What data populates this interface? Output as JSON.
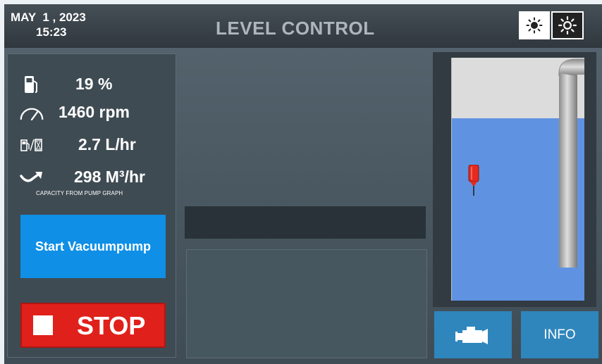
{
  "header": {
    "date": "MAY  1 , 2023",
    "time": "15:23",
    "title": "LEVEL CONTROL",
    "theme_light_icon": "sun-outline-icon",
    "theme_dark_icon": "sun-icon"
  },
  "stats": {
    "fuel": {
      "icon": "fuel-pump-icon",
      "value": "19 %"
    },
    "speed": {
      "icon": "speedometer-icon",
      "value": "1460 rpm"
    },
    "consumption": {
      "icon": "fuel-rate-icon",
      "value": "2.7 L/hr"
    },
    "flow": {
      "icon": "flow-arrow-icon",
      "value": "298 M³/hr"
    },
    "caption": "CAPACITY FROM PUMP GRAPH"
  },
  "controls": {
    "start_label": "Start Vacuumpump",
    "stop_label": "STOP",
    "info_label": "INFO",
    "engine_icon": "engine-icon"
  },
  "tank": {
    "level_fraction": 0.75
  },
  "colors": {
    "start": "#0f8fe6",
    "stop": "#e0201b",
    "water": "#5f93e2",
    "nav_button": "#2f86bd"
  }
}
